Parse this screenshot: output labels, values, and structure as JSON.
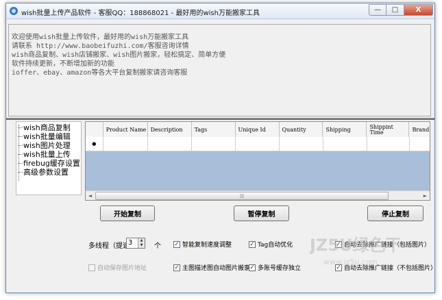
{
  "window": {
    "title": "wish批量上传产品软件 - 客服QQ：188868021 - 最好用的wish万能搬家工具",
    "buttons": {
      "minimize": "—",
      "maximize": "□",
      "close": "X"
    }
  },
  "info_panel": {
    "lines": [
      "欢迎使用wish批量上传软件，最好用的wish万能搬家工具",
      "请联系 http://www.baobeifuzhi.com/客服咨询详情",
      "wish商品复制、wish店铺搬家、wish图片搬家，轻松搞定、简单方便",
      "软件持续更新，不断增加新的功能",
      "ioffer、ebay、amazon等各大平台复制搬家请咨询客服"
    ]
  },
  "nav_tree": {
    "items": [
      "wish商品复制",
      "wish批量编辑",
      "wish图片处理",
      "wish批量上传",
      "firebug缓存设置",
      "高级参数设置"
    ]
  },
  "grid": {
    "columns": [
      "Product Name",
      "Description",
      "Tags",
      "Unique Id",
      "Quantity",
      "Shipping",
      "Shippint Time",
      "Brand"
    ],
    "row_marker": "●",
    "scroll_left": "◄",
    "scroll_right": "►",
    "scroll_grip": "|||"
  },
  "actions": {
    "start": "开始复制",
    "pause": "暂停复制",
    "stop": "停止复制"
  },
  "options": {
    "threads_label": "多线程（提速）",
    "threads_value": "3",
    "threads_unit": "个",
    "spin_up": "▲",
    "spin_down": "▼",
    "check_mark": "✓",
    "smart_speed": "智能复制速度调整",
    "tag_optimize": "Tag自动优化",
    "remove_promo_with_images": "自动去除推广链接（包括图片）",
    "auto_save_image_url": "自动保存图片地址",
    "main_desc_images": "主图描述图自动图片搬家",
    "multi_account_cache": "多账号缓存独立",
    "remove_promo_without_images": "自动去除推广链接（不包括图片）"
  },
  "watermark": {
    "text": "JZ5U绿色下载",
    "url": "www.jz5u.com"
  }
}
